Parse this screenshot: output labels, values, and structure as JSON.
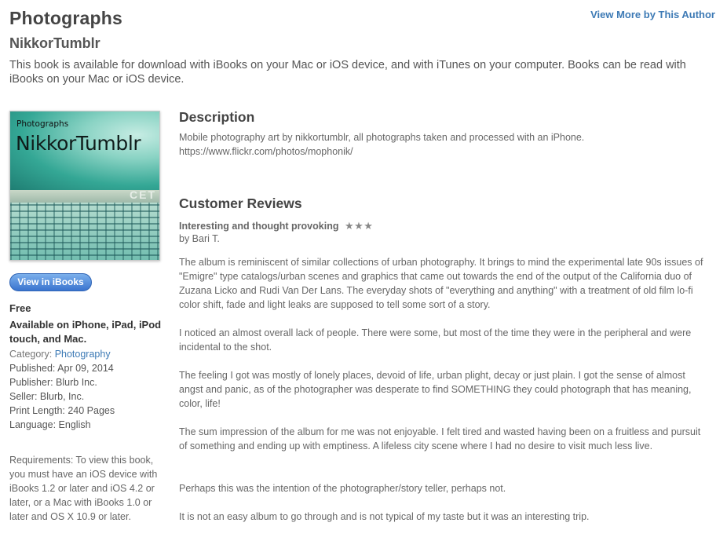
{
  "header": {
    "title": "Photographs",
    "author": "NikkorTumblr",
    "view_more": "View More by This Author",
    "availability": "This book is available for download with iBooks on your Mac or iOS device, and with iTunes on your computer. Books can be read with iBooks on your Mac or iOS device."
  },
  "cover": {
    "kicker": "Photographs",
    "name": "NikkorTumblr",
    "sign": "CET"
  },
  "sidebar": {
    "view_button": "View in iBooks",
    "price": "Free",
    "devices": "Available on iPhone, iPad, iPod touch, and Mac.",
    "category_label": "Category:",
    "category_value": "Photography",
    "published": "Published: Apr 09, 2014",
    "publisher": "Publisher: Blurb Inc.",
    "seller": "Seller: Blurb, Inc.",
    "print_length": "Print Length: 240 Pages",
    "language": "Language: English",
    "requirements": "Requirements: To view this book, you must have an iOS device with iBooks 1.2 or later and iOS 4.2 or later, or a Mac with iBooks 1.0 or later and OS X 10.9 or later."
  },
  "description": {
    "heading": "Description",
    "line1": "Mobile photography art by nikkortumblr, all photographs taken and processed with an iPhone.",
    "line2": "https://www.flickr.com/photos/mophonik/"
  },
  "reviews": {
    "heading": "Customer Reviews",
    "title": "Interesting and thought provoking",
    "stars": "★★★",
    "rating": 3,
    "by": "by Bari T.",
    "paragraphs": [
      "The album is reminiscent of similar collections of urban photography. It brings to mind the experimental late 90s issues of \"Emigre\" type catalogs/urban scenes and graphics that came out towards the end of the output of the California duo of Zuzana Licko and Rudi Van Der Lans. The everyday shots of \"everything and anything\" with a treatment of old film lo-fi color shift, fade and light leaks are supposed to tell some sort of a story.",
      "I noticed an almost overall lack of people. There were some, but most of the time they were in the peripheral and were incidental to the shot.",
      "The feeling I got was mostly of lonely places, devoid of life, urban plight, decay or just plain. I got the sense of almost angst and panic, as of the photographer was desperate to find SOMETHING they could photograph that has meaning, color, life!",
      "The sum impression of the album for me was not enjoyable. I felt tired and wasted having been on a fruitless and pursuit of something and ending up with emptiness. A lifeless city scene where I had no desire to visit much less live.",
      "Perhaps this was the intention of the photographer/story teller, perhaps not.",
      "It is not an easy album to go through and is not typical of my taste but it was an interesting trip."
    ]
  }
}
